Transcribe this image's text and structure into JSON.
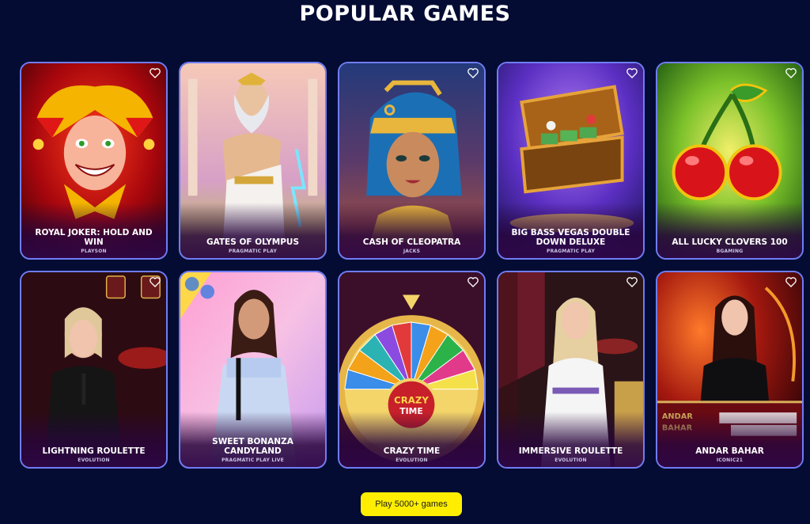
{
  "section": {
    "title": "POPULAR GAMES"
  },
  "games": [
    {
      "name": "ROYAL JOKER: HOLD AND WIN",
      "provider": "PLAYSON",
      "art": "joker-icon"
    },
    {
      "name": "GATES OF OLYMPUS",
      "provider": "PRAGMATIC PLAY",
      "art": "zeus-icon"
    },
    {
      "name": "CASH OF CLEOPATRA",
      "provider": "JACKS",
      "art": "cleopatra-icon"
    },
    {
      "name": "BIG BASS VEGAS DOUBLE DOWN DELUXE",
      "provider": "PRAGMATIC PLAY",
      "art": "cash-case-icon"
    },
    {
      "name": "ALL LUCKY CLOVERS 100",
      "provider": "BGAMING",
      "art": "cherries-icon"
    },
    {
      "name": "LIGHTNING ROULETTE",
      "provider": "EVOLUTION",
      "art": "dealer-icon"
    },
    {
      "name": "SWEET BONANZA CANDYLAND",
      "provider": "PRAGMATIC PLAY LIVE",
      "art": "host-icon"
    },
    {
      "name": "CRAZY TIME",
      "provider": "EVOLUTION",
      "art": "money-wheel-icon"
    },
    {
      "name": "IMMERSIVE ROULETTE",
      "provider": "EVOLUTION",
      "art": "dealer-icon"
    },
    {
      "name": "ANDAR BAHAR",
      "provider": "ICONIC21",
      "art": "dealer-icon"
    }
  ],
  "cta": {
    "label": "Play 5000+ games"
  },
  "colors": {
    "background": "#050c33",
    "card_border": "#6f7df5",
    "cta": "#ffee00"
  }
}
